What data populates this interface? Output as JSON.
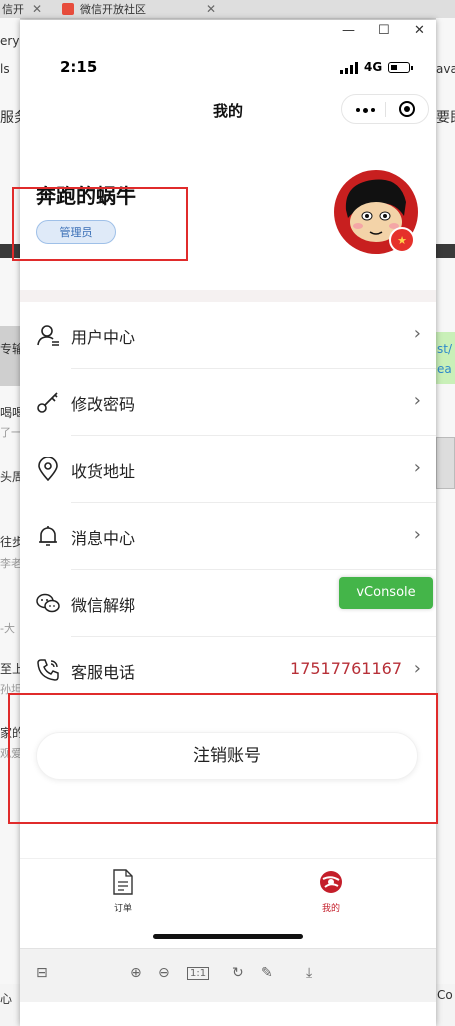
{
  "browser": {
    "tab1_label": "信开",
    "tab2_label": "微信开放社区",
    "left_snippets": [
      "ery=",
      "ls",
      "服务",
      "专输",
      "喝喝",
      "了一",
      "头周",
      "往步",
      "李老",
      "-大",
      "至上",
      "孙坦",
      "家的",
      "观爱",
      "心"
    ],
    "right_snippets": [
      "ava",
      "要即",
      "st/",
      "ea",
      "Co"
    ]
  },
  "status_bar": {
    "time": "2:15",
    "network": "4G"
  },
  "nav": {
    "title": "我的"
  },
  "profile": {
    "username": "奔跑的蜗牛",
    "role": "管理员"
  },
  "menu": [
    {
      "label": "用户中心",
      "icon": "user-icon"
    },
    {
      "label": "修改密码",
      "icon": "key-icon"
    },
    {
      "label": "收货地址",
      "icon": "location-pin-icon"
    },
    {
      "label": "消息中心",
      "icon": "bell-icon"
    },
    {
      "label": "微信解绑",
      "icon": "wechat-icon"
    },
    {
      "label": "客服电话",
      "icon": "phone-icon",
      "value": "17517761167"
    }
  ],
  "vconsole": "vConsole",
  "logout_label": "注销账号",
  "tabbar": [
    {
      "label": "订单",
      "icon": "document-icon"
    },
    {
      "label": "我的",
      "icon": "profile-logo-icon",
      "active": true
    }
  ],
  "toolbar": {
    "zoom_reset": "1:1"
  },
  "colors": {
    "accent": "#b73038",
    "annotation_red": "#e02b2b",
    "vconsole_green": "#44b549",
    "badge_blue": "#dfeaf8"
  }
}
